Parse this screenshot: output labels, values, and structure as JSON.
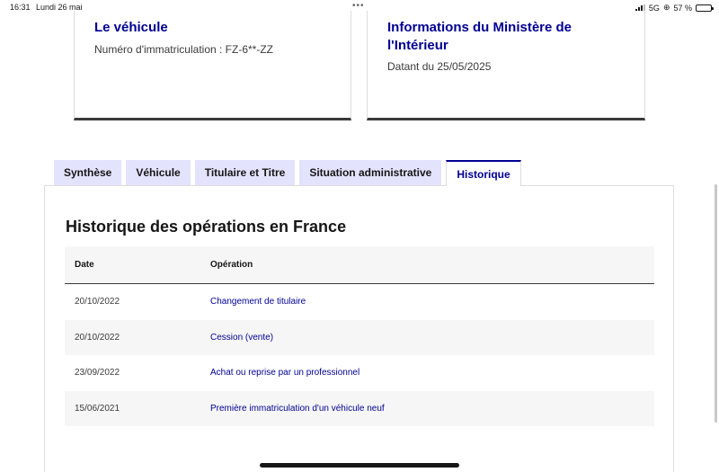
{
  "status_bar": {
    "time": "16:31",
    "date": "Lundi 26 mai",
    "network": "5G",
    "battery_text": "57 %",
    "battery_level": 0.57
  },
  "cards": {
    "vehicule": {
      "title": "Le véhicule",
      "text": "Numéro d'immatriculation : FZ-6**-ZZ"
    },
    "ministere": {
      "title": "Informations du Ministère de l'Intérieur",
      "text": "Datant du 25/05/2025"
    }
  },
  "tabs": [
    {
      "label": "Synthèse",
      "active": false
    },
    {
      "label": "Véhicule",
      "active": false
    },
    {
      "label": "Titulaire et Titre",
      "active": false
    },
    {
      "label": "Situation administrative",
      "active": false
    },
    {
      "label": "Historique",
      "active": true
    }
  ],
  "historique": {
    "title": "Historique des opérations en France",
    "columns": {
      "date": "Date",
      "operation": "Opération"
    },
    "rows": [
      {
        "date": "20/10/2022",
        "operation": "Changement de titulaire"
      },
      {
        "date": "20/10/2022",
        "operation": "Cession (vente)"
      },
      {
        "date": "23/09/2022",
        "operation": "Achat ou reprise par un professionnel"
      },
      {
        "date": "15/06/2021",
        "operation": "Première immatriculation d'un véhicule neuf"
      }
    ]
  },
  "colors": {
    "accent": "#000091",
    "tab_bg": "#e3e3fd",
    "row_alt_bg": "#f6f6f6"
  }
}
